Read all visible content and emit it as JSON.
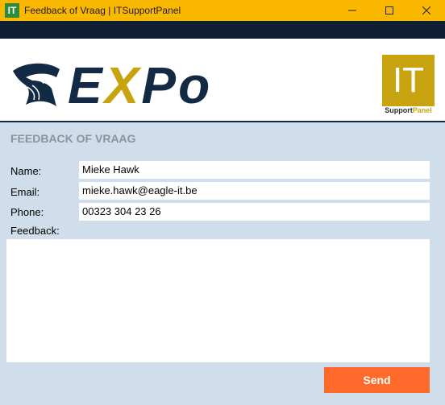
{
  "window": {
    "icon_text": "IT",
    "title": "Feedback of Vraag | ITSupportPanel"
  },
  "logo": {
    "text_part1": "E",
    "text_accent": "X",
    "text_part2": "Po",
    "brand_navy": "#132a45",
    "brand_gold": "#c8a310"
  },
  "badge": {
    "text": "IT",
    "caption_part1": "Support",
    "caption_accent": "Panel"
  },
  "form": {
    "heading": "FEEDBACK OF VRAAG",
    "name_label": "Name:",
    "name_value": "Mieke Hawk",
    "email_label": "Email:",
    "email_value": "mieke.hawk@eagle-it.be",
    "phone_label": "Phone:",
    "phone_value": "00323 304 23 26",
    "feedback_label": "Feedback:",
    "feedback_value": "",
    "send_label": "Send"
  },
  "colors": {
    "titlebar": "#fbb800",
    "background": "#cfdeea",
    "send_button": "#ff6a2b"
  }
}
